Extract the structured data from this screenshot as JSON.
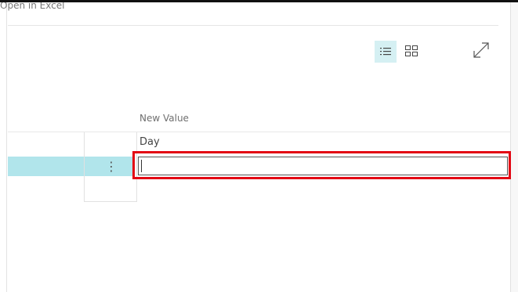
{
  "header": {
    "open_in_excel_label": "Open in Excel"
  },
  "toolbar": {
    "list_view_icon": "list-view-icon",
    "tile_view_icon": "tile-view-icon",
    "expand_icon": "expand-icon"
  },
  "grid": {
    "column_header": "New Value",
    "row": {
      "label": "Day",
      "value": ""
    }
  },
  "colors": {
    "selected_row": "#b1e5eb",
    "active_view": "#d5f0f3",
    "highlight_box": "#e30613"
  }
}
